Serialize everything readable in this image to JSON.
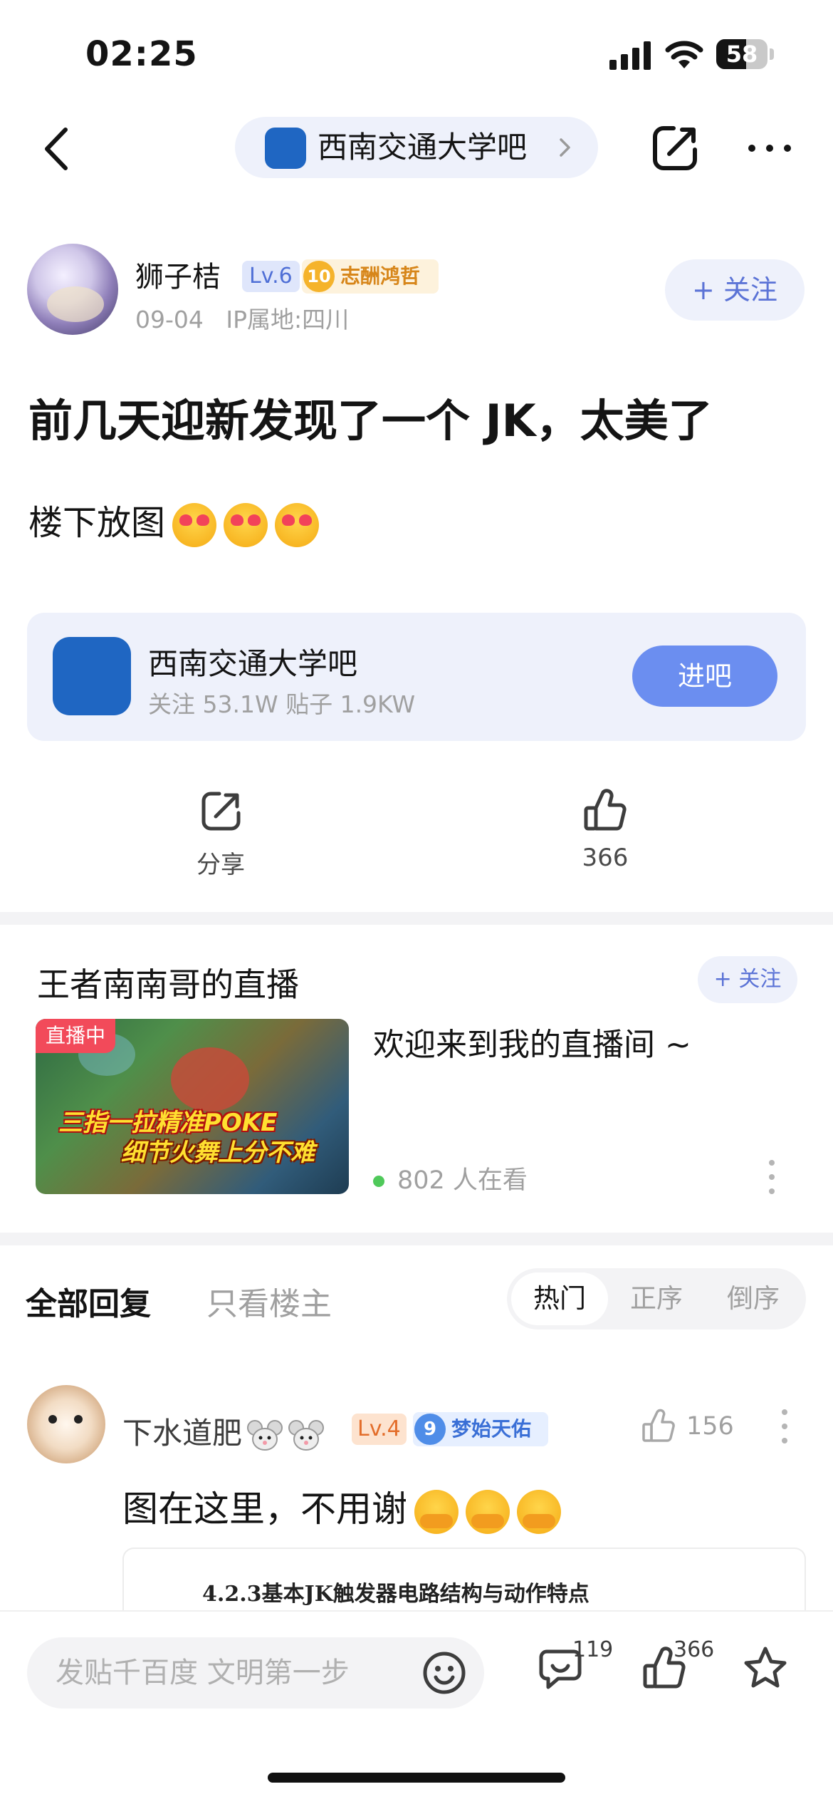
{
  "status_bar": {
    "time": "02:25",
    "battery": "58",
    "battery_level": 0.58
  },
  "nav": {
    "forum_name": "西南交通大学吧"
  },
  "post": {
    "author": "狮子桔",
    "level": "Lv.6",
    "honor_level": "10",
    "honor_title": "志酬鸿哲",
    "date": "09-04",
    "ip": "IP属地:四川",
    "follow_label": "+ 关注",
    "title": "前几天迎新发现了一个 JK，太美了",
    "body": "楼下放图"
  },
  "forum_card": {
    "name": "西南交通大学吧",
    "stats": "关注 53.1W   贴子 1.9KW",
    "enter_label": "进吧"
  },
  "actions": {
    "share_label": "分享",
    "like_count": "366"
  },
  "live": {
    "title": "王者南南哥的直播",
    "follow_label": "+ 关注",
    "badge": "直播中",
    "caption_line1": "三指一拉精准POKE",
    "caption_line2": "细节火舞上分不难",
    "description": "欢迎来到我的直播间 ~",
    "viewers": "802 人在看"
  },
  "replies": {
    "tab_all": "全部回复",
    "tab_owner": "只看楼主",
    "sort": [
      "热门",
      "正序",
      "倒序"
    ],
    "sort_active": "热门"
  },
  "comment": {
    "author": "下水道肥",
    "level": "Lv.4",
    "honor_level": "9",
    "honor_title": "梦始天佑",
    "likes": "156",
    "text": "图在这里，不用谢",
    "image_caption": "4.2.3基本JK触发器电路结构与动作特点"
  },
  "bottom_bar": {
    "input_placeholder": "发贴千百度 文明第一步",
    "comment_count": "119",
    "like_count": "366"
  },
  "colors": {
    "accent": "#6b8ef0",
    "follow_text": "#5b73d6",
    "pill_bg": "#eef1fb",
    "live_badge": "#f24a5a"
  }
}
